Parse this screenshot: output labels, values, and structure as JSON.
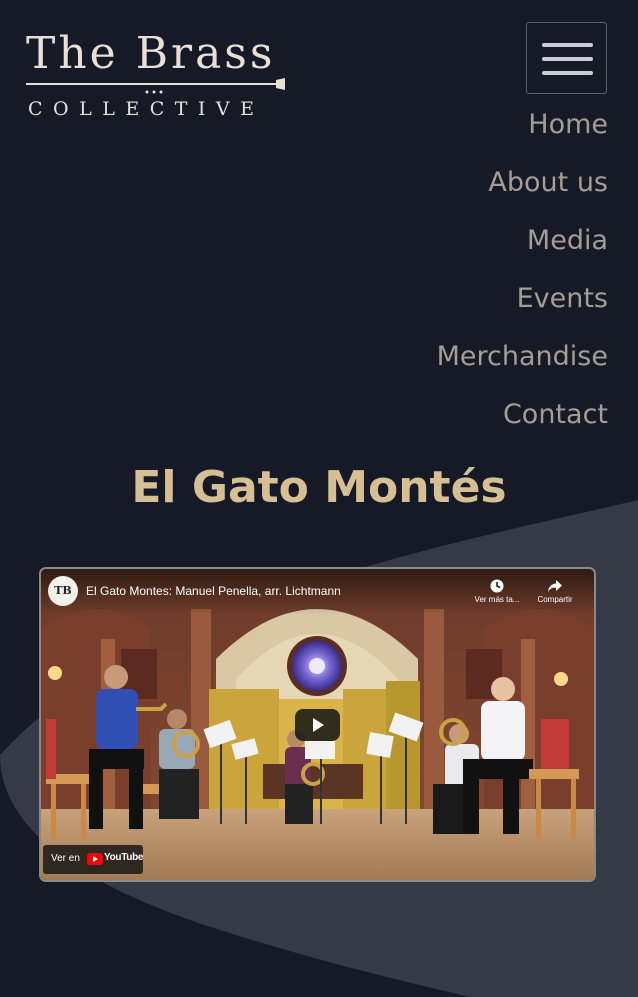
{
  "logo": {
    "title": "The Brass",
    "subtitle": "COLLECTIVE"
  },
  "menu": {
    "toggle_icon": "hamburger-icon"
  },
  "nav": {
    "items": [
      {
        "label": "Home"
      },
      {
        "label": "About us"
      },
      {
        "label": "Media"
      },
      {
        "label": "Events"
      },
      {
        "label": "Merchandise"
      },
      {
        "label": "Contact"
      }
    ]
  },
  "page": {
    "title": "El Gato Montés"
  },
  "video": {
    "channel_initials": "TB",
    "title": "El Gato Montes: Manuel Penella, arr. Lichtmann",
    "watch_later_label": "Ver más ta...",
    "share_label": "Compartir",
    "watch_on_label": "Ver en",
    "youtube_label": "YouTube",
    "play_icon": "play-icon",
    "clock_icon": "clock-icon",
    "share_icon": "share-icon"
  },
  "colors": {
    "background": "#161a26",
    "swoosh": "#353a47",
    "logo_text": "#e8dfd6",
    "nav_text": "#a59d93",
    "title_gold": "#d6bf93",
    "youtube_red": "#ff0000"
  }
}
